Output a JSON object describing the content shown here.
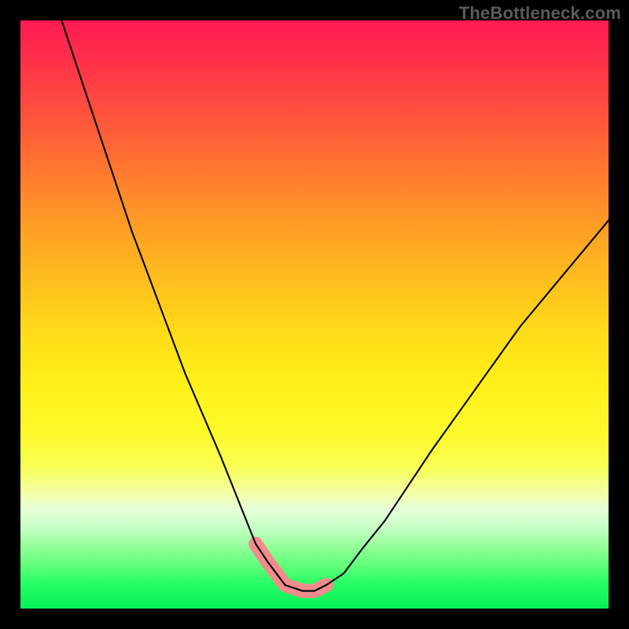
{
  "source_watermark": "TheBottleneck.com",
  "chart_data": {
    "type": "line",
    "title": "",
    "xlabel": "",
    "ylabel": "",
    "xlim": [
      0,
      100
    ],
    "ylim": [
      0,
      100
    ],
    "grid": false,
    "legend": false,
    "series": [
      {
        "name": "curve",
        "x": [
          7,
          10,
          13,
          16,
          19,
          22,
          25,
          28,
          31,
          34,
          36,
          38,
          40,
          42,
          45,
          48,
          50,
          52,
          55,
          58,
          62,
          66,
          70,
          75,
          80,
          85,
          90,
          95,
          100
        ],
        "values": [
          100,
          91,
          82,
          73,
          64,
          56,
          48,
          40,
          33,
          26,
          21,
          16,
          11,
          8,
          4,
          3,
          3,
          4,
          6,
          10,
          15,
          21,
          27,
          34,
          41,
          48,
          54,
          60,
          66
        ]
      }
    ],
    "annotations": [
      {
        "name": "pink-marker-band",
        "kind": "marker-band",
        "color": "#f28b8b",
        "x_range": [
          36,
          52
        ],
        "y_max": 12
      }
    ],
    "background": {
      "type": "vertical-gradient",
      "stops": [
        {
          "pos": 0.0,
          "color": "#ff1a52"
        },
        {
          "pos": 0.3,
          "color": "#ff8a2a"
        },
        {
          "pos": 0.55,
          "color": "#ffde18"
        },
        {
          "pos": 0.8,
          "color": "#f4ffa0"
        },
        {
          "pos": 0.92,
          "color": "#6aff82"
        },
        {
          "pos": 1.0,
          "color": "#07f05a"
        }
      ]
    }
  }
}
